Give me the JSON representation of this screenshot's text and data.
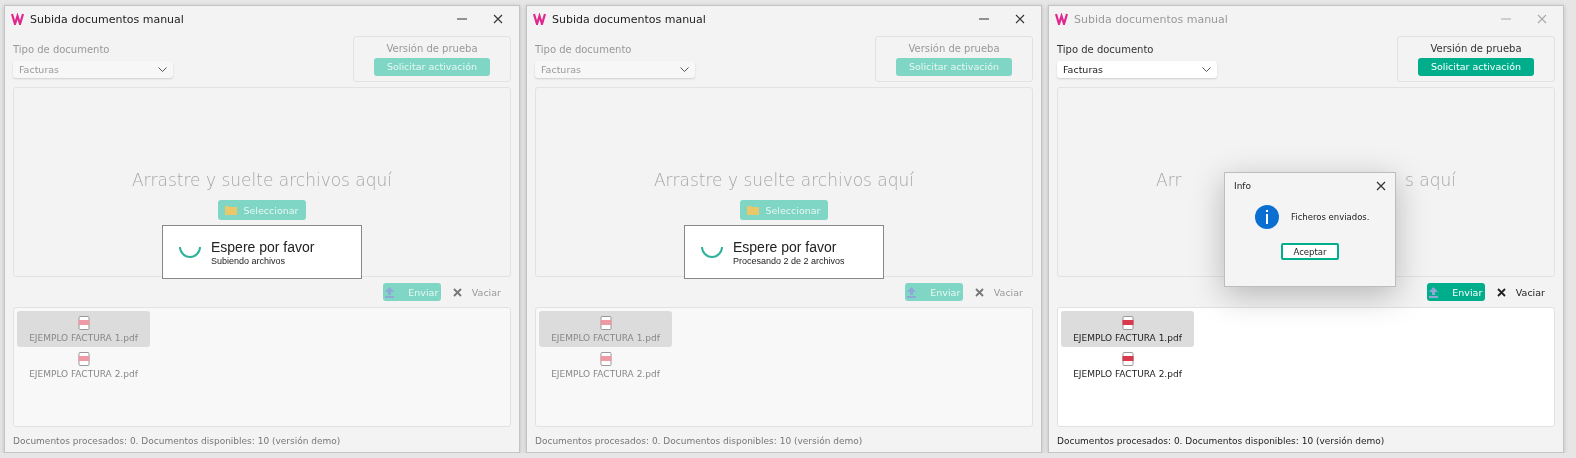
{
  "windows": [
    {
      "title": "Subida documentos manual",
      "active": true,
      "disabled": true,
      "doc_type_label": "Tipo de documento",
      "doc_type_value": "Facturas",
      "trial_title": "Versión de prueba",
      "trial_button": "Solicitar activación",
      "drop_text": "Arrastre y suelte archivos aquí",
      "select_button": "Seleccionar",
      "send_button": "Enviar",
      "clear_button": "Vaciar",
      "files": [
        {
          "name": "EJEMPLO FACTURA 1.pdf",
          "selected": true
        },
        {
          "name": "EJEMPLO FACTURA 2.pdf",
          "selected": false
        }
      ],
      "status": "Documentos procesados: 0.  Documentos disponibles: 10  (versión demo)",
      "overlay": {
        "kind": "progress",
        "title": "Espere por favor",
        "message": "Subiendo archivos"
      }
    },
    {
      "title": "Subida documentos manual",
      "active": true,
      "disabled": true,
      "doc_type_label": "Tipo de documento",
      "doc_type_value": "Facturas",
      "trial_title": "Versión de prueba",
      "trial_button": "Solicitar activación",
      "drop_text": "Arrastre y suelte archivos aquí",
      "select_button": "Seleccionar",
      "send_button": "Enviar",
      "clear_button": "Vaciar",
      "files": [
        {
          "name": "EJEMPLO FACTURA 1.pdf",
          "selected": true
        },
        {
          "name": "EJEMPLO FACTURA 2.pdf",
          "selected": false
        }
      ],
      "status": "Documentos procesados: 0.  Documentos disponibles: 10  (versión demo)",
      "overlay": {
        "kind": "progress",
        "title": "Espere por favor",
        "message": "Procesando 2 de 2 archivos"
      }
    },
    {
      "title": "Subida documentos manual",
      "active": false,
      "disabled": false,
      "doc_type_label": "Tipo de documento",
      "doc_type_value": "Facturas",
      "trial_title": "Versión de prueba",
      "trial_button": "Solicitar activación",
      "drop_text_fragments": [
        "Arr",
        "s aquí"
      ],
      "send_button": "Enviar",
      "clear_button": "Vaciar",
      "files": [
        {
          "name": "EJEMPLO FACTURA 1.pdf",
          "selected": true
        },
        {
          "name": "EJEMPLO FACTURA 2.pdf",
          "selected": false
        }
      ],
      "status": "Documentos procesados: 0.  Documentos disponibles: 10  (versión demo)",
      "overlay": {
        "kind": "info",
        "title": "Info",
        "message": "Ficheros enviados.",
        "button": "Aceptar"
      }
    }
  ]
}
